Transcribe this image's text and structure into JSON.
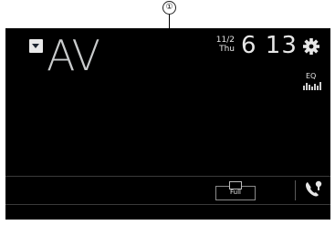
{
  "callout": {
    "number": "①"
  },
  "source": {
    "name": "AV"
  },
  "clock": {
    "date": "11/2",
    "weekday": "Thu",
    "time": "6 13"
  },
  "eq": {
    "label": "EQ"
  },
  "bottom_bar": {
    "display_mode_label": "Full"
  },
  "icons": {
    "source_menu": "triangle-down-icon",
    "settings": "gear-icon",
    "eq": "equalizer-bars-icon",
    "phone": "phone-icon"
  },
  "colors": {
    "screen": "#000000",
    "text": "#e6e6e6",
    "source_text": "#c9cbcc"
  }
}
